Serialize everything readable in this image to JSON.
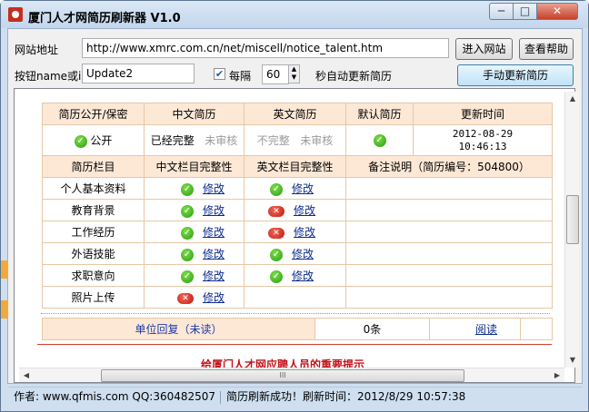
{
  "window": {
    "title": "厦门人才网简历刷新器 V1.0",
    "min": "─",
    "max": "□",
    "close": "✕"
  },
  "form": {
    "site_label": "网站地址",
    "site_url": "http://www.xmrc.com.cn/net/miscell/notice_talent.htm",
    "enter_site": "进入网站",
    "help": "查看帮助",
    "button_name_label": "按钮name或id",
    "button_name_value": "Update2",
    "interval_checked": true,
    "interval_label": "每隔",
    "interval_value": "60",
    "interval_suffix": "秒自动更新简历",
    "manual_update": "手动更新简历"
  },
  "resume_status": {
    "headers": [
      "简历公开/保密",
      "中文简历",
      "英文简历",
      "默认简历",
      "更新时间"
    ],
    "public": "公开",
    "cn_complete": "已经完整",
    "cn_review": "未审核",
    "en_complete": "不完整",
    "en_review": "未审核",
    "update_date": "2012-08-29",
    "update_time": "10:46:13"
  },
  "sections": {
    "headers": [
      "简历栏目",
      "中文栏目完整性",
      "英文栏目完整性",
      "备注说明（简历编号：504800）"
    ],
    "edit_label": "修改",
    "rows": [
      {
        "name": "个人基本资料",
        "cn": "ok",
        "en": "ok"
      },
      {
        "name": "教育背景",
        "cn": "ok",
        "en": "no"
      },
      {
        "name": "工作经历",
        "cn": "ok",
        "en": "no"
      },
      {
        "name": "外语技能",
        "cn": "ok",
        "en": "ok"
      },
      {
        "name": "求职意向",
        "cn": "ok",
        "en": "ok"
      },
      {
        "name": "照片上传",
        "cn": "no",
        "en": ""
      }
    ]
  },
  "replies": {
    "label": "单位回复（未读）",
    "count": "0条",
    "read": "阅读"
  },
  "notice": "给厦门人才网应聘人员的重要提示",
  "scroll_grip": "III",
  "status": {
    "author": "作者: www.qfmis.com QQ:360482507",
    "message": "简历刷新成功！刷新时间：2012/8/29 10:57:38"
  }
}
